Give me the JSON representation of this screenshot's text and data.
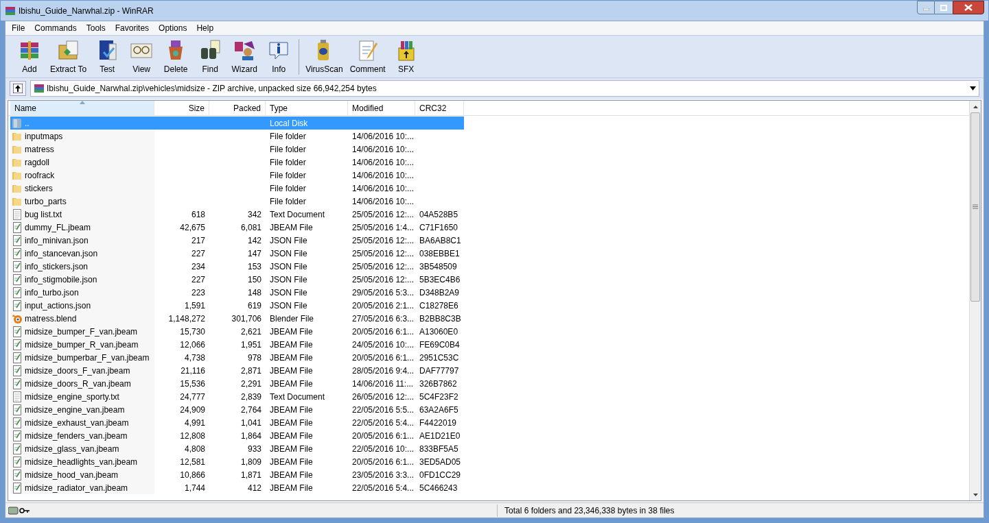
{
  "window": {
    "title": "Ibishu_Guide_Narwhal.zip - WinRAR"
  },
  "menu": [
    "File",
    "Commands",
    "Tools",
    "Favorites",
    "Options",
    "Help"
  ],
  "toolbar_groups": [
    {
      "buttons": [
        {
          "label": "Add",
          "kind": "add"
        },
        {
          "label": "Extract To",
          "kind": "extract"
        },
        {
          "label": "Test",
          "kind": "test"
        },
        {
          "label": "View",
          "kind": "view"
        },
        {
          "label": "Delete",
          "kind": "delete"
        },
        {
          "label": "Find",
          "kind": "find"
        },
        {
          "label": "Wizard",
          "kind": "wizard"
        },
        {
          "label": "Info",
          "kind": "info"
        }
      ]
    },
    {
      "buttons": [
        {
          "label": "VirusScan",
          "kind": "virus"
        },
        {
          "label": "Comment",
          "kind": "comment"
        },
        {
          "label": "SFX",
          "kind": "sfx"
        }
      ]
    }
  ],
  "address": {
    "path": "Ibishu_Guide_Narwhal.zip\\vehicles\\midsize - ZIP archive, unpacked size 66,942,254 bytes"
  },
  "table": {
    "columns": [
      "Name",
      "Size",
      "Packed",
      "Type",
      "Modified",
      "CRC32"
    ],
    "rows": [
      {
        "kind": "parent",
        "name": "..",
        "size": "",
        "packed": "",
        "type": "Local Disk",
        "modified": "",
        "crc": "",
        "selected": true
      },
      {
        "kind": "folder",
        "name": "inputmaps",
        "size": "",
        "packed": "",
        "type": "File folder",
        "modified": "14/06/2016 10:...",
        "crc": "",
        "selected": false
      },
      {
        "kind": "folder",
        "name": "matress",
        "size": "",
        "packed": "",
        "type": "File folder",
        "modified": "14/06/2016 10:...",
        "crc": "",
        "selected": false
      },
      {
        "kind": "folder",
        "name": "ragdoll",
        "size": "",
        "packed": "",
        "type": "File folder",
        "modified": "14/06/2016 10:...",
        "crc": "",
        "selected": false
      },
      {
        "kind": "folder",
        "name": "roofrack",
        "size": "",
        "packed": "",
        "type": "File folder",
        "modified": "14/06/2016 10:...",
        "crc": "",
        "selected": false
      },
      {
        "kind": "folder",
        "name": "stickers",
        "size": "",
        "packed": "",
        "type": "File folder",
        "modified": "14/06/2016 10:...",
        "crc": "",
        "selected": false
      },
      {
        "kind": "folder",
        "name": "turbo_parts",
        "size": "",
        "packed": "",
        "type": "File folder",
        "modified": "14/06/2016 10:...",
        "crc": "",
        "selected": false
      },
      {
        "kind": "text",
        "name": "bug list.txt",
        "size": "618",
        "packed": "342",
        "type": "Text Document",
        "modified": "25/05/2016 12:...",
        "crc": "04A528B5",
        "selected": false
      },
      {
        "kind": "file",
        "name": "dummy_FL.jbeam",
        "size": "42,675",
        "packed": "6,081",
        "type": "JBEAM File",
        "modified": "25/05/2016 1:4...",
        "crc": "C71F1650",
        "selected": false
      },
      {
        "kind": "file",
        "name": "info_minivan.json",
        "size": "217",
        "packed": "142",
        "type": "JSON File",
        "modified": "25/05/2016 12:...",
        "crc": "BA6AB8C1",
        "selected": false
      },
      {
        "kind": "file",
        "name": "info_stancevan.json",
        "size": "227",
        "packed": "147",
        "type": "JSON File",
        "modified": "25/05/2016 12:...",
        "crc": "038EBBE1",
        "selected": false
      },
      {
        "kind": "file",
        "name": "info_stickers.json",
        "size": "234",
        "packed": "153",
        "type": "JSON File",
        "modified": "25/05/2016 12:...",
        "crc": "3B548509",
        "selected": false
      },
      {
        "kind": "file",
        "name": "info_stigmobile.json",
        "size": "227",
        "packed": "150",
        "type": "JSON File",
        "modified": "25/05/2016 12:...",
        "crc": "5B3EC4B6",
        "selected": false
      },
      {
        "kind": "file",
        "name": "info_turbo.json",
        "size": "223",
        "packed": "148",
        "type": "JSON File",
        "modified": "29/05/2016 5:3...",
        "crc": "D348B2A9",
        "selected": false
      },
      {
        "kind": "file",
        "name": "input_actions.json",
        "size": "1,591",
        "packed": "619",
        "type": "JSON File",
        "modified": "20/05/2016 2:1...",
        "crc": "C18278E6",
        "selected": false
      },
      {
        "kind": "blend",
        "name": "matress.blend",
        "size": "1,148,272",
        "packed": "301,706",
        "type": "Blender File",
        "modified": "27/05/2016 6:3...",
        "crc": "B2BB8C3B",
        "selected": false
      },
      {
        "kind": "file",
        "name": "midsize_bumper_F_van.jbeam",
        "size": "15,730",
        "packed": "2,621",
        "type": "JBEAM File",
        "modified": "20/05/2016 6:1...",
        "crc": "A13060E0",
        "selected": false
      },
      {
        "kind": "file",
        "name": "midsize_bumper_R_van.jbeam",
        "size": "12,066",
        "packed": "1,951",
        "type": "JBEAM File",
        "modified": "24/05/2016 10:...",
        "crc": "FE69C0B4",
        "selected": false
      },
      {
        "kind": "file",
        "name": "midsize_bumperbar_F_van.jbeam",
        "size": "4,738",
        "packed": "978",
        "type": "JBEAM File",
        "modified": "20/05/2016 6:1...",
        "crc": "2951C53C",
        "selected": false
      },
      {
        "kind": "file",
        "name": "midsize_doors_F_van.jbeam",
        "size": "21,116",
        "packed": "2,871",
        "type": "JBEAM File",
        "modified": "28/05/2016 9:4...",
        "crc": "DAF77797",
        "selected": false
      },
      {
        "kind": "file",
        "name": "midsize_doors_R_van.jbeam",
        "size": "15,536",
        "packed": "2,291",
        "type": "JBEAM File",
        "modified": "14/06/2016 11:...",
        "crc": "326B7862",
        "selected": false
      },
      {
        "kind": "text",
        "name": "midsize_engine_sporty.txt",
        "size": "24,777",
        "packed": "2,839",
        "type": "Text Document",
        "modified": "26/05/2016 12:...",
        "crc": "5C4F23F2",
        "selected": false
      },
      {
        "kind": "file",
        "name": "midsize_engine_van.jbeam",
        "size": "24,909",
        "packed": "2,764",
        "type": "JBEAM File",
        "modified": "22/05/2016 5:5...",
        "crc": "63A2A6F5",
        "selected": false
      },
      {
        "kind": "file",
        "name": "midsize_exhaust_van.jbeam",
        "size": "4,991",
        "packed": "1,041",
        "type": "JBEAM File",
        "modified": "22/05/2016 5:4...",
        "crc": "F4422019",
        "selected": false
      },
      {
        "kind": "file",
        "name": "midsize_fenders_van.jbeam",
        "size": "12,808",
        "packed": "1,864",
        "type": "JBEAM File",
        "modified": "20/05/2016 6:1...",
        "crc": "AE1D21E0",
        "selected": false
      },
      {
        "kind": "file",
        "name": "midsize_glass_van.jbeam",
        "size": "4,808",
        "packed": "933",
        "type": "JBEAM File",
        "modified": "22/05/2016 10:...",
        "crc": "833BF5A5",
        "selected": false
      },
      {
        "kind": "file",
        "name": "midsize_headlights_van.jbeam",
        "size": "12,581",
        "packed": "1,809",
        "type": "JBEAM File",
        "modified": "20/05/2016 6:1...",
        "crc": "3ED5AD05",
        "selected": false
      },
      {
        "kind": "file",
        "name": "midsize_hood_van.jbeam",
        "size": "10,866",
        "packed": "1,871",
        "type": "JBEAM File",
        "modified": "23/05/2016 3:3...",
        "crc": "0FD1CC29",
        "selected": false
      },
      {
        "kind": "file",
        "name": "midsize_radiator_van.jbeam",
        "size": "1,744",
        "packed": "412",
        "type": "JBEAM File",
        "modified": "22/05/2016 5:4...",
        "crc": "5C466243",
        "selected": false
      }
    ]
  },
  "status_bar": {
    "text": "Total 6 folders and 23,346,338 bytes in 38 files"
  }
}
